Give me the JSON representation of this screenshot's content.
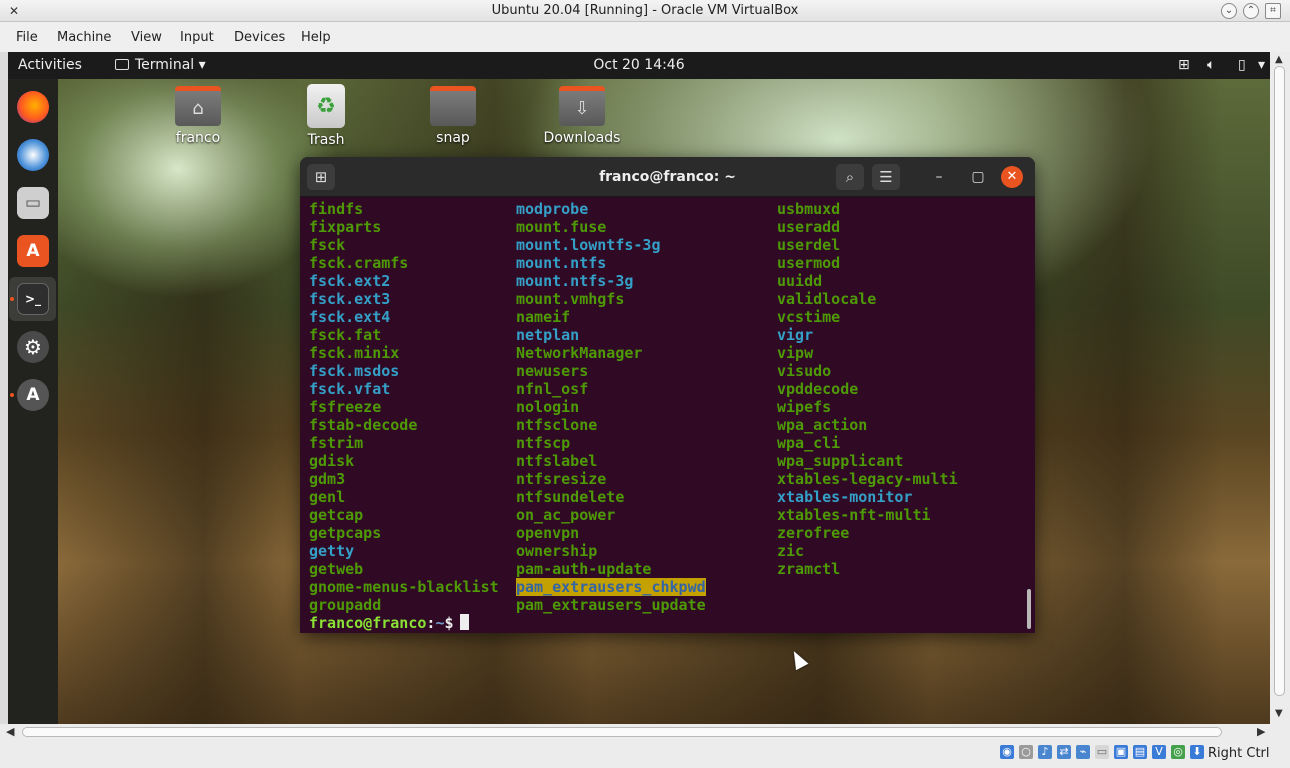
{
  "host": {
    "title": "Ubuntu 20.04 [Running] - Oracle VM VirtualBox",
    "menu": [
      "File",
      "Machine",
      "View",
      "Input",
      "Devices",
      "Help"
    ],
    "host_key": "Right Ctrl"
  },
  "topbar": {
    "activities": "Activities",
    "app_menu": "Terminal",
    "clock": "Oct 20  14:46"
  },
  "dock": [
    "firefox-icon",
    "thunderbird-icon",
    "files-icon",
    "software-center-icon",
    "terminal-icon",
    "settings-icon",
    "software-updater-icon"
  ],
  "desktop": {
    "icons": [
      {
        "label": "franco",
        "kind": "home-folder-icon"
      },
      {
        "label": "Trash",
        "kind": "trash-icon"
      },
      {
        "label": "snap",
        "kind": "folder-icon"
      },
      {
        "label": "Downloads",
        "kind": "downloads-folder-icon"
      }
    ]
  },
  "terminal": {
    "title": "franco@franco: ~",
    "columns": [
      [
        {
          "t": "findfs",
          "c": "g"
        },
        {
          "t": "fixparts",
          "c": "g"
        },
        {
          "t": "fsck",
          "c": "g"
        },
        {
          "t": "fsck.cramfs",
          "c": "g"
        },
        {
          "t": "fsck.ext2",
          "c": "b"
        },
        {
          "t": "fsck.ext3",
          "c": "b"
        },
        {
          "t": "fsck.ext4",
          "c": "b"
        },
        {
          "t": "fsck.fat",
          "c": "g"
        },
        {
          "t": "fsck.minix",
          "c": "g"
        },
        {
          "t": "fsck.msdos",
          "c": "b"
        },
        {
          "t": "fsck.vfat",
          "c": "b"
        },
        {
          "t": "fsfreeze",
          "c": "g"
        },
        {
          "t": "fstab-decode",
          "c": "g"
        },
        {
          "t": "fstrim",
          "c": "g"
        },
        {
          "t": "gdisk",
          "c": "g"
        },
        {
          "t": "gdm3",
          "c": "g"
        },
        {
          "t": "genl",
          "c": "g"
        },
        {
          "t": "getcap",
          "c": "g"
        },
        {
          "t": "getpcaps",
          "c": "g"
        },
        {
          "t": "getty",
          "c": "b"
        },
        {
          "t": "getweb",
          "c": "g"
        },
        {
          "t": "gnome-menus-blacklist",
          "c": "g"
        },
        {
          "t": "groupadd",
          "c": "g"
        }
      ],
      [
        {
          "t": "modprobe",
          "c": "b"
        },
        {
          "t": "mount.fuse",
          "c": "g"
        },
        {
          "t": "mount.lowntfs-3g",
          "c": "b"
        },
        {
          "t": "mount.ntfs",
          "c": "b"
        },
        {
          "t": "mount.ntfs-3g",
          "c": "b"
        },
        {
          "t": "mount.vmhgfs",
          "c": "g"
        },
        {
          "t": "nameif",
          "c": "g"
        },
        {
          "t": "netplan",
          "c": "b"
        },
        {
          "t": "NetworkManager",
          "c": "g"
        },
        {
          "t": "newusers",
          "c": "g"
        },
        {
          "t": "nfnl_osf",
          "c": "g"
        },
        {
          "t": "nologin",
          "c": "g"
        },
        {
          "t": "ntfsclone",
          "c": "g"
        },
        {
          "t": "ntfscp",
          "c": "g"
        },
        {
          "t": "ntfslabel",
          "c": "g"
        },
        {
          "t": "ntfsresize",
          "c": "g"
        },
        {
          "t": "ntfsundelete",
          "c": "g"
        },
        {
          "t": "on_ac_power",
          "c": "g"
        },
        {
          "t": "openvpn",
          "c": "g"
        },
        {
          "t": "ownership",
          "c": "g"
        },
        {
          "t": "pam-auth-update",
          "c": "g"
        },
        {
          "t": "pam_extrausers_chkpwd",
          "c": "hl"
        },
        {
          "t": "pam_extrausers_update",
          "c": "g"
        }
      ],
      [
        {
          "t": "usbmuxd",
          "c": "g"
        },
        {
          "t": "useradd",
          "c": "g"
        },
        {
          "t": "userdel",
          "c": "g"
        },
        {
          "t": "usermod",
          "c": "g"
        },
        {
          "t": "uuidd",
          "c": "g"
        },
        {
          "t": "validlocale",
          "c": "g"
        },
        {
          "t": "vcstime",
          "c": "g"
        },
        {
          "t": "vigr",
          "c": "b"
        },
        {
          "t": "vipw",
          "c": "g"
        },
        {
          "t": "visudo",
          "c": "g"
        },
        {
          "t": "vpddecode",
          "c": "g"
        },
        {
          "t": "wipefs",
          "c": "g"
        },
        {
          "t": "wpa_action",
          "c": "g"
        },
        {
          "t": "wpa_cli",
          "c": "g"
        },
        {
          "t": "wpa_supplicant",
          "c": "g"
        },
        {
          "t": "xtables-legacy-multi",
          "c": "g"
        },
        {
          "t": "xtables-monitor",
          "c": "b"
        },
        {
          "t": "xtables-nft-multi",
          "c": "g"
        },
        {
          "t": "zerofree",
          "c": "g"
        },
        {
          "t": "zic",
          "c": "g"
        },
        {
          "t": "zramctl",
          "c": "g"
        }
      ]
    ],
    "prompt": {
      "user": "franco@franco",
      "sep": ":",
      "path": "~",
      "end": "$"
    }
  }
}
